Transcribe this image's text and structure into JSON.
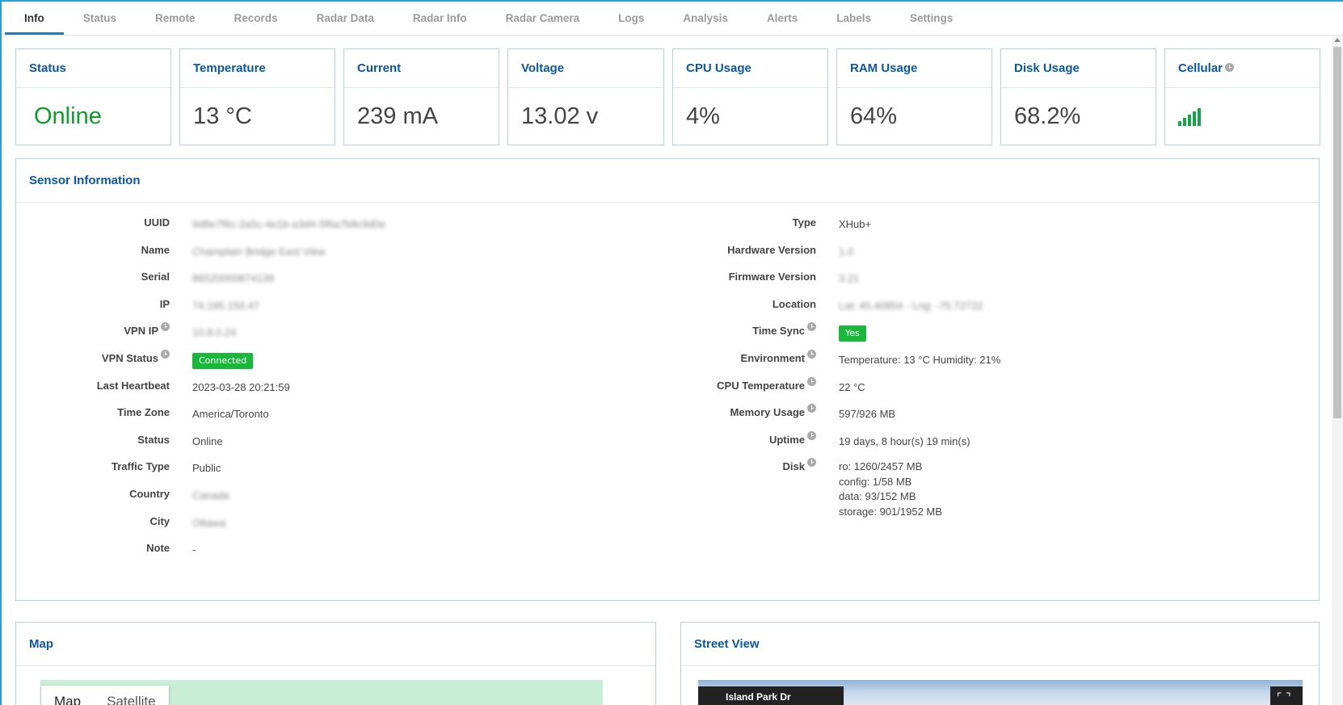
{
  "tabs": [
    "Info",
    "Status",
    "Remote",
    "Records",
    "Radar Data",
    "Radar Info",
    "Radar Camera",
    "Logs",
    "Analysis",
    "Alerts",
    "Labels",
    "Settings"
  ],
  "active_tab": "Info",
  "cards": {
    "status": {
      "title": "Status",
      "value": "Online"
    },
    "temperature": {
      "title": "Temperature",
      "value": "13 °C"
    },
    "current": {
      "title": "Current",
      "value": "239 mA"
    },
    "voltage": {
      "title": "Voltage",
      "value": "13.02 v"
    },
    "cpu": {
      "title": "CPU Usage",
      "value": "4%"
    },
    "ram": {
      "title": "RAM Usage",
      "value": "64%"
    },
    "disk": {
      "title": "Disk Usage",
      "value": "68.2%"
    },
    "cellular": {
      "title": "Cellular",
      "signal_bars": 5,
      "bar_color": "#16a34a"
    }
  },
  "sensor": {
    "title": "Sensor Information",
    "left": [
      {
        "label": "UUID",
        "value": "9d8e7f6c-2a5c-4e1b-a3d4-5f6a7b8c9d0e",
        "blurred": true
      },
      {
        "label": "Name",
        "value": "Champlain Bridge East View",
        "blurred": true
      },
      {
        "label": "Serial",
        "value": "86520000874139",
        "blurred": true
      },
      {
        "label": "IP",
        "value": "74.195.150.47",
        "blurred": true
      },
      {
        "label": "VPN IP",
        "value": "10.8.0.24",
        "blurred": true,
        "info": true
      },
      {
        "label": "VPN Status",
        "value": "Connected",
        "badge": true,
        "info": true
      },
      {
        "label": "Last Heartbeat",
        "value": "2023-03-28 20:21:59"
      },
      {
        "label": "Time Zone",
        "value": "America/Toronto"
      },
      {
        "label": "Status",
        "value": "Online"
      },
      {
        "label": "Traffic Type",
        "value": "Public"
      },
      {
        "label": "Country",
        "value": "Canada",
        "blurred": true
      },
      {
        "label": "City",
        "value": "Ottawa",
        "blurred": true
      },
      {
        "label": "Note",
        "value": "-"
      }
    ],
    "right": [
      {
        "label": "Type",
        "value": "XHub+"
      },
      {
        "label": "Hardware Version",
        "value": "1.0",
        "blurred": true
      },
      {
        "label": "Firmware Version",
        "value": "3.21",
        "blurred": true
      },
      {
        "label": "Location",
        "value": "Lat: 45.40854 - Lng: -75.72722",
        "blurred": true
      },
      {
        "label": "Time Sync",
        "value": "Yes",
        "badge": true,
        "info": true
      },
      {
        "label": "Environment",
        "value": "Temperature: 13 °C Humidity: 21%",
        "info": true
      },
      {
        "label": "CPU Temperature",
        "value": "22 °C",
        "info": true
      },
      {
        "label": "Memory Usage",
        "value": "597/926 MB",
        "info": true
      },
      {
        "label": "Uptime",
        "value": "19 days, 8 hour(s) 19 min(s)",
        "info": true
      }
    ],
    "disk": {
      "label": "Disk",
      "lines": [
        "ro: 1260/2457 MB",
        "config: 1/58 MB",
        "data: 93/152 MB",
        "storage: 901/1952 MB"
      ]
    }
  },
  "map": {
    "title": "Map",
    "map_button": "Map",
    "satellite_button": "Satellite"
  },
  "street_view": {
    "title": "Street View",
    "street_name": "Island Park Dr"
  },
  "colors": {
    "accent": "#0b57a4",
    "online": "#0b9e2a",
    "badge": "#19b73a"
  }
}
